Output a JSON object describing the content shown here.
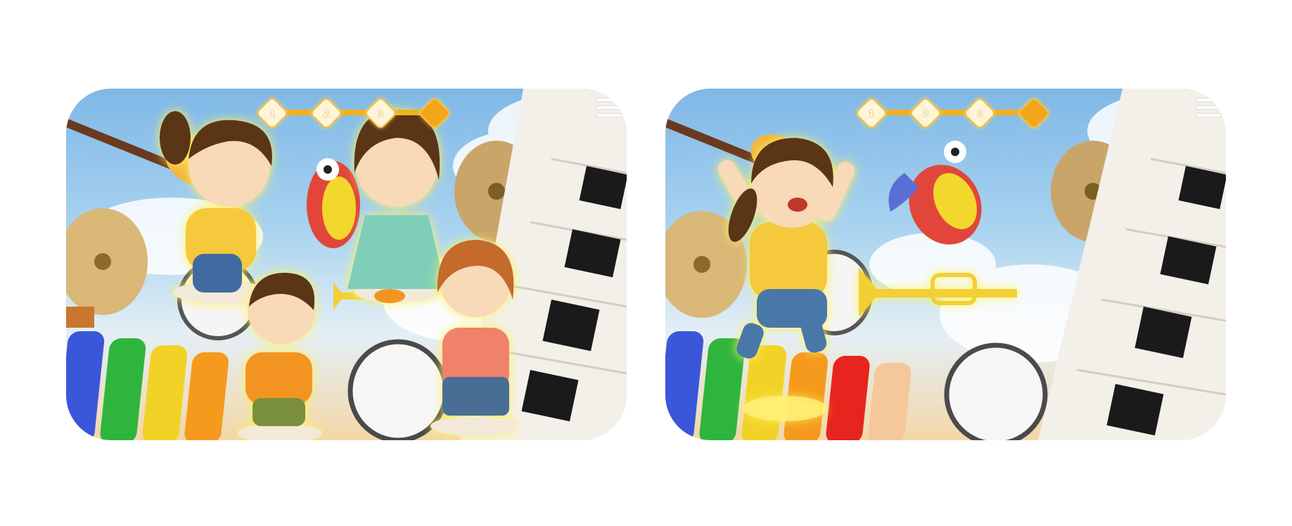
{
  "screens": [
    {
      "id": "left",
      "progress": {
        "steps": [
          "1",
          "2",
          "3",
          ""
        ],
        "fill": 0.9
      },
      "characters": [
        "ponytail-girl",
        "teal-dress-girl",
        "orange-shirt-boy",
        "red-haired-girl"
      ],
      "scene_objects": [
        "guitar",
        "parrot",
        "cymbal",
        "drum",
        "trumpet",
        "xylophone",
        "piano-keys"
      ]
    },
    {
      "id": "right",
      "progress": {
        "steps": [
          "1",
          "2",
          "3",
          ""
        ],
        "fill": 0.9
      },
      "characters": [
        "jumping-girl"
      ],
      "scene_objects": [
        "guitar",
        "parrot",
        "cymbal",
        "drum",
        "trumpet",
        "xylophone",
        "piano-keys"
      ]
    }
  ],
  "colors": {
    "glow": "#fff25a",
    "progress_fill": "#f2b01e",
    "sky": "#8ec3ea"
  }
}
